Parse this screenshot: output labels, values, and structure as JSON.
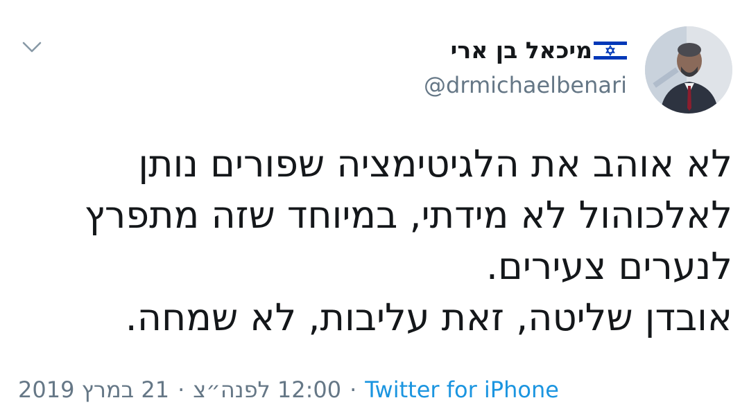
{
  "profile": {
    "display_name": "מיכאל בן ארי",
    "handle": "@drmichaelbenari",
    "flag_icon": "israel-flag-icon",
    "avatar_icon": "profile-photo"
  },
  "header": {
    "menu_icon": "chevron-down-icon"
  },
  "tweet": {
    "lines": [
      "לא אוהב את הלגיטימציה שפורים נותן",
      "לאלכוהול לא מידתי, במיוחד שזה מתפרץ",
      "לנערים צעירים.",
      "אובדן שליטה, זאת עליבות, לא שמחה."
    ]
  },
  "meta": {
    "date": "21 במרץ 2019",
    "time": "12:00 לפנה״צ",
    "separator": "·",
    "source": "Twitter for iPhone"
  },
  "colors": {
    "text": "#14171a",
    "secondary": "#657786",
    "link": "#1b95e0",
    "flag_blue": "#0038b8"
  }
}
